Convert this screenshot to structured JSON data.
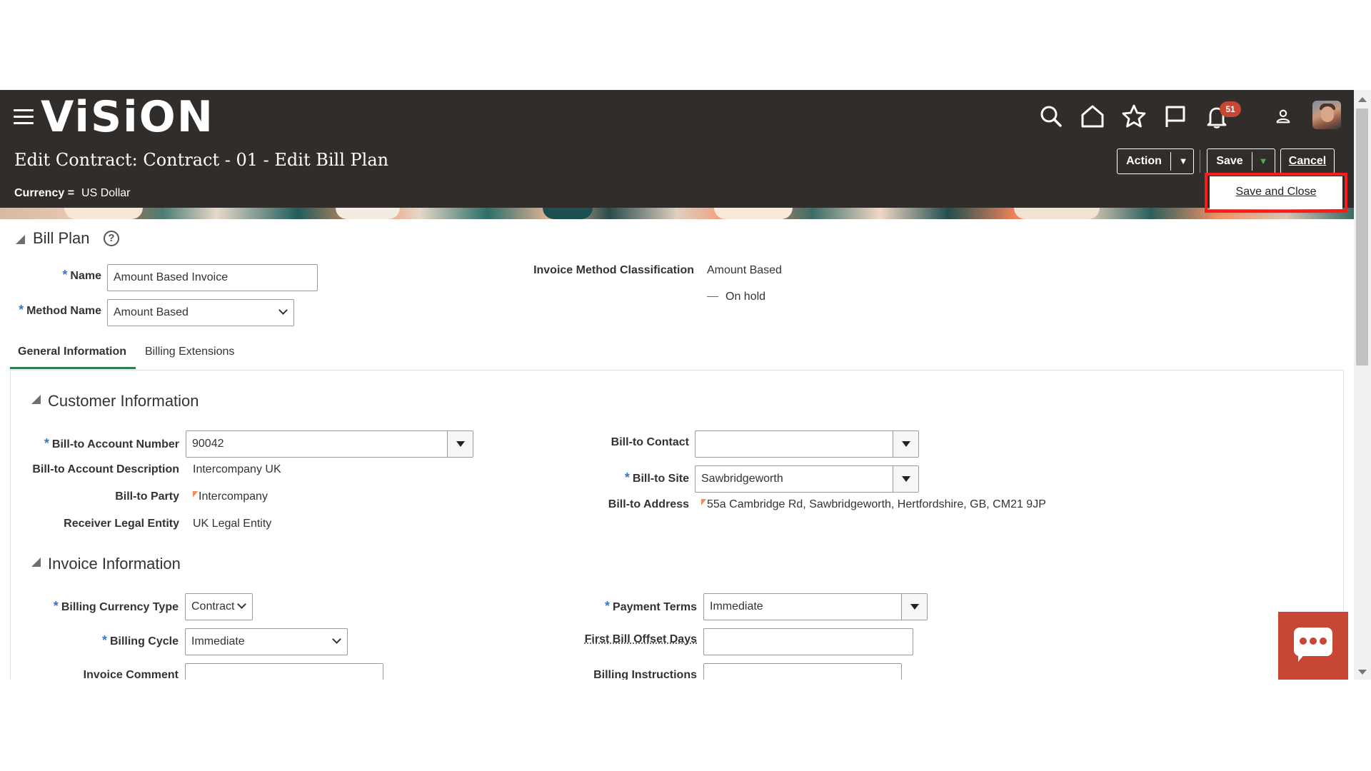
{
  "header": {
    "logo": "ViSiON",
    "notification_count": "51",
    "page_title": "Edit Contract: Contract - 01 - Edit Bill Plan",
    "currency_label": "Currency =",
    "currency_value": "US Dollar",
    "buttons": {
      "action": "Action",
      "save": "Save",
      "cancel": "Cancel",
      "save_and_close": "Save and Close"
    },
    "icons": [
      "menu-icon",
      "search-icon",
      "home-icon",
      "favorites-star-icon",
      "flag-icon",
      "bell-icon",
      "user-icon",
      "avatar"
    ]
  },
  "bill_plan": {
    "section_title": "Bill Plan",
    "help_glyph": "?",
    "name_label": "Name",
    "name_value": "Amount Based Invoice",
    "method_label": "Method Name",
    "method_value": "Amount Based",
    "invoice_method_class_label": "Invoice Method Classification",
    "invoice_method_class_value": "Amount Based",
    "on_hold_label": "On hold"
  },
  "tabs": [
    "General Information",
    "Billing Extensions"
  ],
  "customer_info": {
    "title": "Customer Information",
    "bill_to_account_number_label": "Bill-to Account Number",
    "bill_to_account_number_value": "90042",
    "bill_to_account_description_label": "Bill-to Account Description",
    "bill_to_account_description_value": "Intercompany UK",
    "bill_to_party_label": "Bill-to Party",
    "bill_to_party_value": "Intercompany",
    "receiver_legal_entity_label": "Receiver Legal Entity",
    "receiver_legal_entity_value": "UK Legal Entity",
    "bill_to_contact_label": "Bill-to Contact",
    "bill_to_contact_value": "",
    "bill_to_site_label": "Bill-to Site",
    "bill_to_site_value": "Sawbridgeworth",
    "bill_to_address_label": "Bill-to Address",
    "bill_to_address_value": "55a Cambridge Rd, Sawbridgeworth, Hertfordshire, GB, CM21 9JP"
  },
  "invoice_info": {
    "title": "Invoice Information",
    "billing_currency_type_label": "Billing Currency Type",
    "billing_currency_type_value": "Contract",
    "billing_cycle_label": "Billing Cycle",
    "billing_cycle_value": "Immediate",
    "invoice_comment_label": "Invoice Comment",
    "payment_terms_label": "Payment Terms",
    "payment_terms_value": "Immediate",
    "first_bill_offset_days_label": "First Bill Offset Days",
    "billing_instructions_label": "Billing Instructions"
  },
  "colors": {
    "header_bg": "#312d2a",
    "required_asterisk": "#3b78c3",
    "active_tab_underline": "#2e7d54",
    "highlight_border": "#ff1a1a",
    "chat_button": "#c74634"
  }
}
